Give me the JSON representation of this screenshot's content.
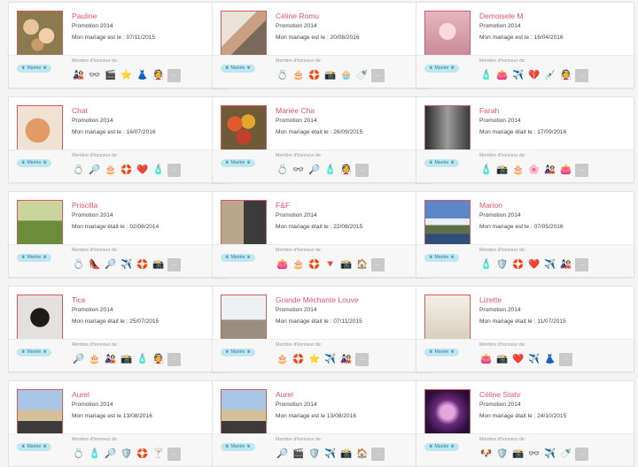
{
  "labels": {
    "role": "Mariée",
    "honor": "Membre d'honneur de:",
    "more": "..."
  },
  "colors": {
    "name": "#e0566a",
    "role_bg": "#bfe7f1",
    "role_text": "#2f7f97",
    "avatar_border": "#d65c5c"
  },
  "cards": [
    {
      "name": "Pauline",
      "promo": "Promotion 2014",
      "wedding": "Mon mariage est le : 07/11/2015",
      "photo": "flowers-icon",
      "badges": [
        "🎎",
        "👓",
        "🎬",
        "⭐",
        "👗",
        "👰"
      ]
    },
    {
      "name": "Céline Romu",
      "promo": "Promotion 2014",
      "wedding": "Mon mariage est le : 20/08/2016",
      "photo": "couple-icon",
      "badges": [
        "💍",
        "🎂",
        "🛟",
        "📸",
        "🧁",
        "🍼"
      ]
    },
    {
      "name": "Demoisele M",
      "promo": "Promotion 2014",
      "wedding": "Mon mariage est le : 16/04/2016",
      "photo": "bouquet-icon",
      "badges": [
        "🧴",
        "👛",
        "✈️",
        "💔",
        "💉",
        "👰"
      ]
    },
    {
      "name": "Chat",
      "promo": "Promotion 2014",
      "wedding": "Mon mariage est le : 16/07/2016",
      "photo": "cat-icon",
      "badges": [
        "💍",
        "🔎",
        "🎂",
        "🛟",
        "❤️",
        "🧴"
      ]
    },
    {
      "name": "Mariée Cha",
      "promo": "Promotion 2014",
      "wedding": "Mon mariage était le : 26/09/2015",
      "photo": "roses-icon",
      "badges": [
        "💍",
        "👓",
        "🔎",
        "🧴",
        "👰"
      ]
    },
    {
      "name": "Farah",
      "promo": "Promotion 2014",
      "wedding": "Mon mariage était le : 17/09/2016",
      "photo": "dress-icon",
      "badges": [
        "🧴",
        "📸",
        "🎂",
        "🌸",
        "🎎",
        "👛"
      ]
    },
    {
      "name": "Priscilla",
      "promo": "Promotion 2014",
      "wedding": "Mon mariage était le : 02/08/2014",
      "photo": "hands-icon",
      "badges": [
        "💍",
        "👠",
        "🔎",
        "✈️",
        "🛟",
        "📸"
      ]
    },
    {
      "name": "F&F",
      "promo": "Promotion 2014",
      "wedding": "Mon mariage était le : 22/08/2015",
      "photo": "couple2-icon",
      "badges": [
        "👛",
        "🎂",
        "🛟",
        "🔻",
        "📸",
        "🏠"
      ]
    },
    {
      "name": "Marion",
      "promo": "Promotion 2014",
      "wedding": "Mon mariage est le : 07/05/2016",
      "photo": "mountain-icon",
      "badges": [
        "🧴",
        "🛡️",
        "🛟",
        "❤️",
        "✈️",
        "🎎"
      ]
    },
    {
      "name": "Tice",
      "promo": "Promotion 2014",
      "wedding": "Mon mariage était le : 25/07/2015",
      "photo": "shoe-icon",
      "badges": [
        "🔎",
        "🎂",
        "🎎",
        "📸",
        "🧴",
        "👰"
      ]
    },
    {
      "name": "Grande Méchante Louve",
      "promo": "Promotion 2014",
      "wedding": "Mon mariage était le : 07/11/2015",
      "photo": "walk-icon",
      "badges": [
        "🎂",
        "🛟",
        "⭐",
        "✈️",
        "🎎"
      ]
    },
    {
      "name": "Lizette",
      "promo": "Promotion 2014",
      "wedding": "Mon mariage était le : 11/07/2015",
      "photo": "polaroid-icon",
      "badges": [
        "👛",
        "📸",
        "❤️",
        "✈️",
        "👗"
      ]
    },
    {
      "name": "Aurel",
      "promo": "Promotion 2014",
      "wedding": "Mon mariage est le 13/08/2016",
      "photo": "castle-icon",
      "badges": [
        "💍",
        "🧴",
        "🔎",
        "🛡️",
        "🛟",
        "🍸"
      ]
    },
    {
      "name": "Aurel",
      "promo": "Promotion 2014",
      "wedding": "Mon mariage est le 13/08/2016",
      "photo": "castle-icon",
      "badges": [
        "🔎",
        "🎬",
        "🛡️",
        "✈️",
        "📸",
        "🏠"
      ]
    },
    {
      "name": "Céline Stahr",
      "promo": "Promotion 2014",
      "wedding": "Mon mariage était le : 24/10/2015",
      "photo": "night-icon",
      "badges": [
        "🐶",
        "🛡️",
        "📸",
        "👓",
        "✈️",
        "🍼"
      ]
    }
  ]
}
